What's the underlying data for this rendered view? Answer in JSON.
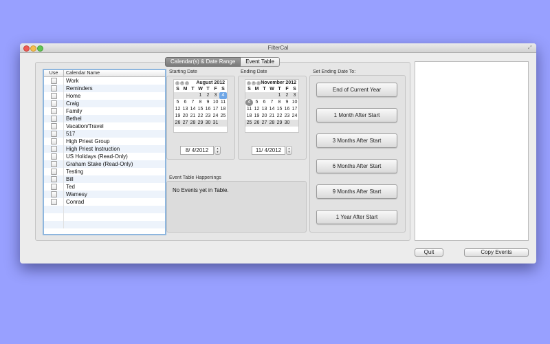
{
  "window": {
    "title": "FilterCal"
  },
  "tabs": [
    {
      "label": "Calendar(s) & Date Range"
    },
    {
      "label": "Event Table"
    }
  ],
  "table": {
    "headers": {
      "use": "Use",
      "name": "Calendar Name"
    },
    "rows": [
      "Work",
      "Reminders",
      "Home",
      "Craig",
      "Family",
      "Bethel",
      "Vacation/Travel",
      "517",
      "High Priest Group",
      "High Priest Instruction",
      "US Holidays (Read-Only)",
      "Graham Stake (Read-Only)",
      "Testing",
      "Bill",
      "Ted",
      "Wamesy",
      "Conrad"
    ]
  },
  "starting": {
    "label": "Starting Date",
    "month": "August 2012",
    "dow": [
      "S",
      "M",
      "T",
      "W",
      "T",
      "F",
      "S"
    ],
    "weeks": [
      [
        "",
        "",
        "",
        "1",
        "2",
        "3",
        "4"
      ],
      [
        "5",
        "6",
        "7",
        "8",
        "9",
        "10",
        "11"
      ],
      [
        "12",
        "13",
        "14",
        "15",
        "16",
        "17",
        "18"
      ],
      [
        "19",
        "20",
        "21",
        "22",
        "23",
        "24",
        "25"
      ],
      [
        "26",
        "27",
        "28",
        "29",
        "30",
        "31",
        ""
      ]
    ],
    "value": "8/ 4/2012"
  },
  "ending": {
    "label": "Ending Date",
    "month": "November 2012",
    "dow": [
      "S",
      "M",
      "T",
      "W",
      "T",
      "F",
      "S"
    ],
    "weeks": [
      [
        "",
        "",
        "",
        "",
        "1",
        "2",
        "3"
      ],
      [
        "4",
        "5",
        "6",
        "7",
        "8",
        "9",
        "10"
      ],
      [
        "11",
        "12",
        "13",
        "14",
        "15",
        "16",
        "17"
      ],
      [
        "18",
        "19",
        "20",
        "21",
        "22",
        "23",
        "24"
      ],
      [
        "25",
        "26",
        "27",
        "28",
        "29",
        "30",
        ""
      ]
    ],
    "value": "11/ 4/2012"
  },
  "set_ending": {
    "label": "Set Ending Date To:",
    "buttons": [
      "End of Current Year",
      "1 Month After Start",
      "3 Months After Start",
      "6 Months After Start",
      "9 Months After Start",
      "1 Year After Start"
    ]
  },
  "events": {
    "label": "Event Table Happenings",
    "text": "No Events yet in Table."
  },
  "bottom": {
    "quit": "Quit",
    "copy": "Copy Events"
  }
}
